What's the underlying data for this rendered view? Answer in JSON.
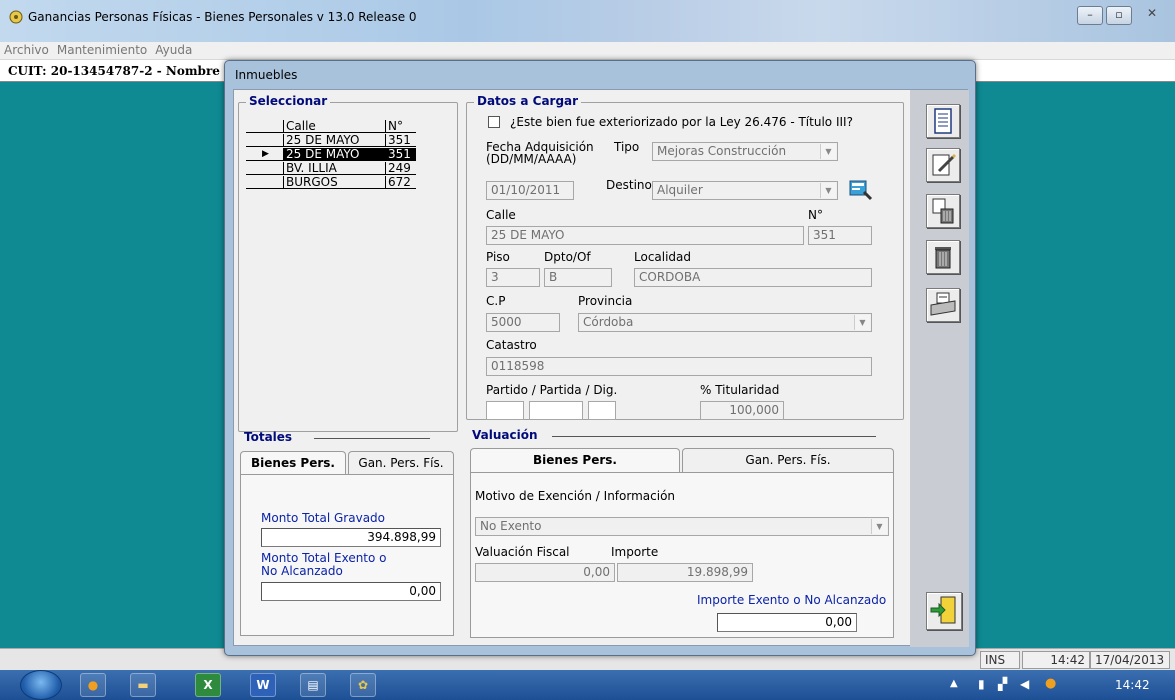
{
  "window": {
    "title": "Ganancias Personas Físicas - Bienes Personales v 13.0 Release 0"
  },
  "menu": [
    "Archivo",
    "Mantenimiento",
    "Ayuda"
  ],
  "cuit_bar": "CUIT: 20-13454787-2 - Nombre",
  "dialog": {
    "title": "Inmuebles",
    "seleccionar": {
      "label": "Seleccionar",
      "columns": [
        "Calle",
        "N°"
      ],
      "rows": [
        {
          "calle": "25 DE MAYO",
          "num": "351"
        },
        {
          "calle": "25 DE MAYO",
          "num": "351"
        },
        {
          "calle": "BV. ILLIA",
          "num": "249"
        },
        {
          "calle": "BURGOS",
          "num": "672"
        }
      ],
      "selected_index": 1
    },
    "totales": {
      "label": "Totales",
      "tabs": [
        "Bienes Pers.",
        "Gan. Pers. Fís."
      ],
      "monto_total_gravado_label": "Monto Total Gravado",
      "monto_total_gravado": "394.898,99",
      "monto_exento_label1": "Monto Total Exento  o",
      "monto_exento_label2": "No Alcanzado",
      "monto_exento": "0,00"
    },
    "datos": {
      "label": "Datos a Cargar",
      "exteriorizado_label": "¿Este bien fue exteriorizado por la Ley 26.476 - Título III?",
      "exteriorizado_checked": false,
      "fecha_label1": "Fecha Adquisición",
      "fecha_label2": "(DD/MM/AAAA)",
      "fecha": "01/10/2011",
      "tipo_label": "Tipo",
      "tipo": "Mejoras Construcción",
      "destino_label": "Destino",
      "destino": "Alquiler",
      "calle_label": "Calle",
      "calle": "25 DE MAYO",
      "num_label": "N°",
      "num": "351",
      "piso_label": "Piso",
      "piso": "3",
      "dpto_label": "Dpto/Of",
      "dpto": "B",
      "localidad_label": "Localidad",
      "localidad": "CORDOBA",
      "cp_label": "C.P",
      "cp": "5000",
      "provincia_label": "Provincia",
      "provincia": "Córdoba",
      "catastro_label": "Catastro",
      "catastro": "0118598",
      "partido_label": "Partido / Partida / Dig.",
      "titularidad_label": "% Titularidad",
      "titularidad": "100,000"
    },
    "valuacion": {
      "label": "Valuación",
      "tabs": [
        "Bienes Pers.",
        "Gan. Pers. Fís."
      ],
      "motivo_label": "Motivo de Exención / Información",
      "motivo": "No Exento",
      "valuacion_fiscal_label": "Valuación Fiscal",
      "valuacion_fiscal": "0,00",
      "importe_label": "Importe",
      "importe": "19.898,99",
      "importe_exento_label": "Importe Exento o No Alcanzado",
      "importe_exento": "0,00"
    }
  },
  "statusbar": {
    "mode": "INS",
    "time": "14:42",
    "date": "17/04/2013"
  },
  "taskbar": {
    "clock": "14:42"
  }
}
